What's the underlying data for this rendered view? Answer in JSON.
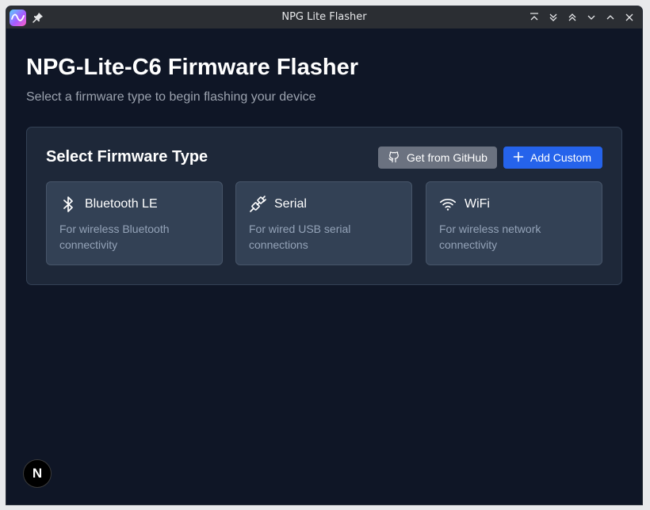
{
  "window": {
    "title": "NPG Lite Flasher"
  },
  "page": {
    "title": "NPG-Lite-C6 Firmware Flasher",
    "subtitle": "Select a firmware type to begin flashing your device"
  },
  "panel": {
    "title": "Select Firmware Type",
    "github_button": "Get from GitHub",
    "custom_button": "Add Custom"
  },
  "firmware_types": [
    {
      "icon": "bluetooth-icon",
      "title": "Bluetooth LE",
      "description": "For wireless Bluetooth connectivity"
    },
    {
      "icon": "usb-cable-icon",
      "title": "Serial",
      "description": "For wired USB serial connections"
    },
    {
      "icon": "wifi-icon",
      "title": "WiFi",
      "description": "For wireless network connectivity"
    }
  ],
  "badge": {
    "letter": "N"
  },
  "colors": {
    "background": "#0f1626",
    "panel": "#1e2839",
    "card": "#334155",
    "primary": "#2563eb",
    "secondary": "#6b7280"
  }
}
